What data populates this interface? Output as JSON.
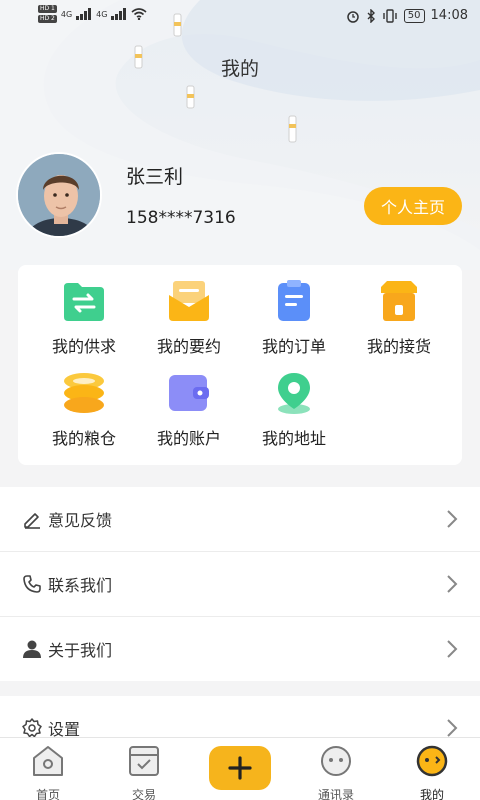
{
  "status_bar": {
    "time": "14:08",
    "battery": "50",
    "hd1": "HD 1",
    "hd2": "HD 2",
    "net1": "4G",
    "net2": "4G"
  },
  "page": {
    "title": "我的"
  },
  "profile": {
    "name": "张三利",
    "phone": "158****7316",
    "home_button": "个人主页"
  },
  "grid": [
    {
      "label": "我的供求",
      "icon": "folder-exchange-icon"
    },
    {
      "label": "我的要约",
      "icon": "mail-envelope-icon"
    },
    {
      "label": "我的订单",
      "icon": "order-document-icon"
    },
    {
      "label": "我的接货",
      "icon": "shop-box-icon"
    },
    {
      "label": "我的粮仓",
      "icon": "granary-stack-icon"
    },
    {
      "label": "我的账户",
      "icon": "wallet-icon"
    },
    {
      "label": "我的地址",
      "icon": "location-pin-icon"
    }
  ],
  "menu": [
    {
      "label": "意见反馈",
      "icon": "edit-pen-icon"
    },
    {
      "label": "联系我们",
      "icon": "phone-icon"
    },
    {
      "label": "关于我们",
      "icon": "user-icon"
    },
    {
      "label": "设置",
      "icon": "settings-gear-icon"
    }
  ],
  "tabs": [
    {
      "label": "首页",
      "icon": "home-icon"
    },
    {
      "label": "交易",
      "icon": "trade-box-icon"
    },
    {
      "label": "",
      "icon": "plus-icon"
    },
    {
      "label": "通讯录",
      "icon": "chat-bubble-icon"
    },
    {
      "label": "我的",
      "icon": "profile-face-icon"
    }
  ],
  "colors": {
    "accent": "#fbb516",
    "green": "#3fcf8e",
    "blue": "#5b8ff9"
  }
}
